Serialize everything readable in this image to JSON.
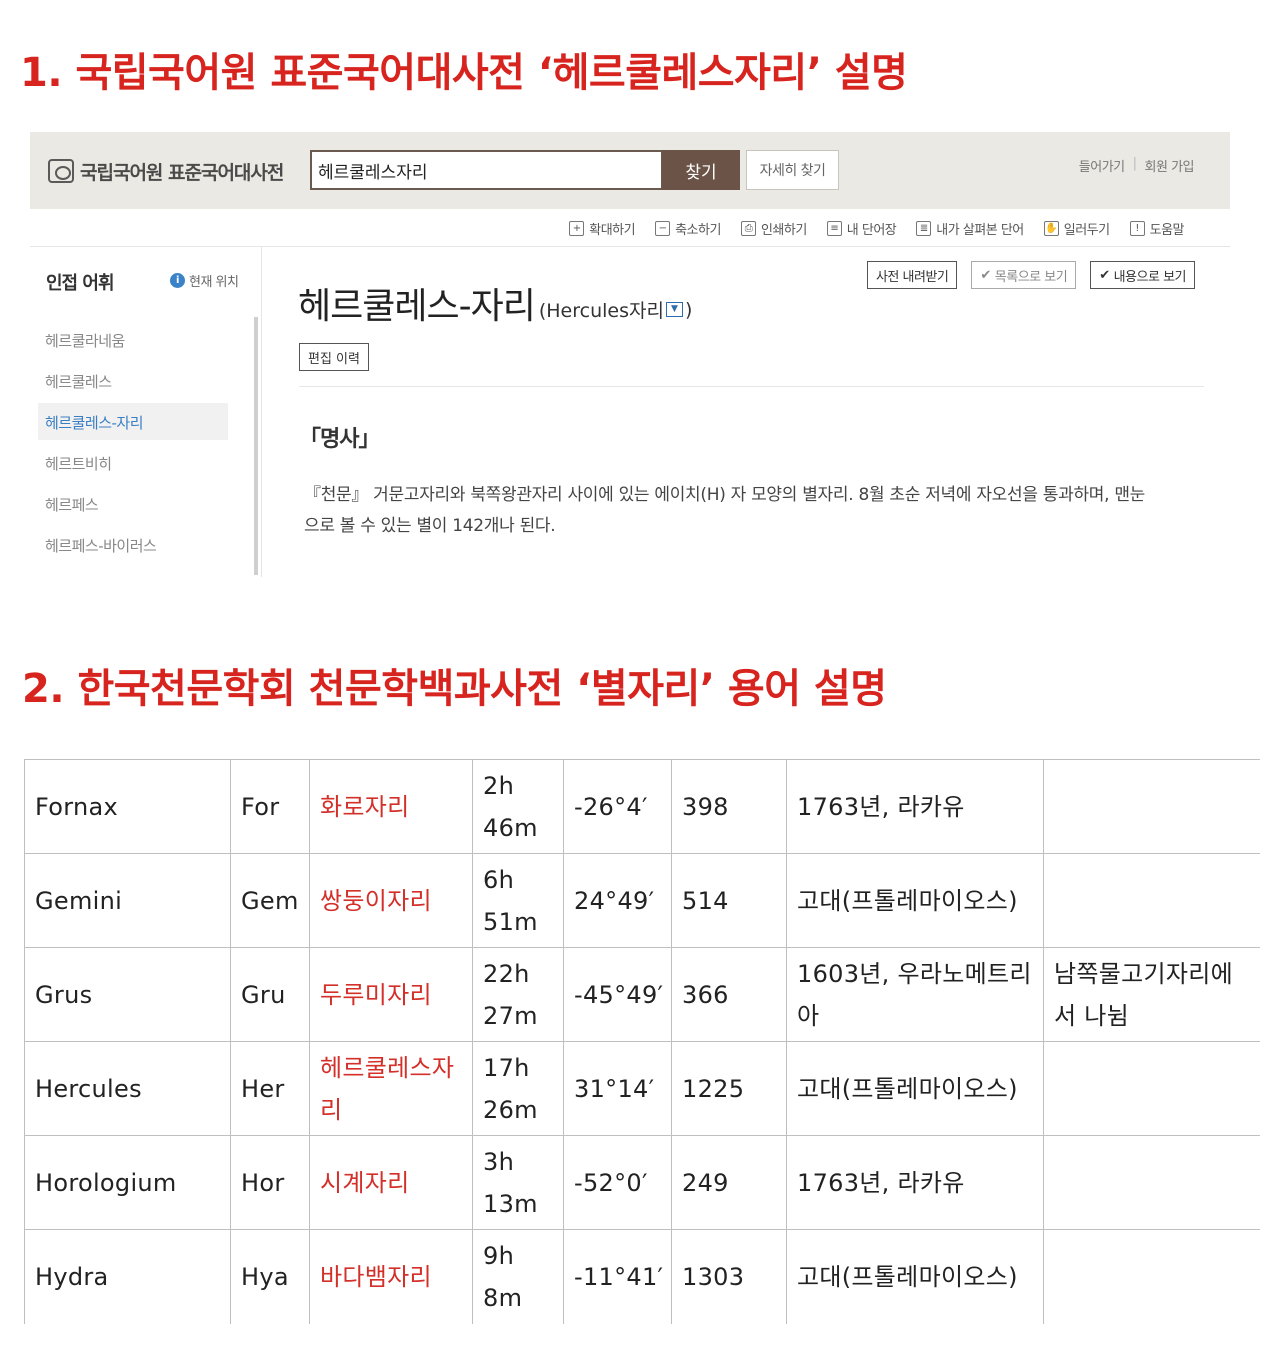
{
  "headings": {
    "first": "1. 국립국어원 표준국어대사전 ‘헤르쿨레스자리’ 설명",
    "second": "2. 한국천문학회 천문학백과사전 ‘별자리’ 용어 설명"
  },
  "dictionary": {
    "logo_text": "국립국어원 표준국어대사전",
    "search": {
      "value": "헤르쿨레스자리",
      "button": "찾기",
      "detail_button": "자세히 찾기"
    },
    "auth": {
      "login": "들어가기",
      "signup": "회원 가입"
    },
    "toolbar": [
      {
        "icon": "zoom-in-icon",
        "glyph": "+",
        "label": "확대하기"
      },
      {
        "icon": "zoom-out-icon",
        "glyph": "−",
        "label": "축소하기"
      },
      {
        "icon": "print-icon",
        "glyph": "⎙",
        "label": "인쇄하기"
      },
      {
        "icon": "wordbook-icon",
        "glyph": "≡",
        "label": "내 단어장"
      },
      {
        "icon": "viewed-words-icon",
        "glyph": "≣",
        "label": "내가 살펴본 단어"
      },
      {
        "icon": "report-icon",
        "glyph": "✋",
        "label": "일러두기"
      },
      {
        "icon": "help-icon",
        "glyph": "!",
        "label": "도움말"
      }
    ],
    "sidebar": {
      "title": "인접 어휘",
      "location": "현재 위치",
      "items": [
        {
          "label": "헤르쿨라네움",
          "active": false
        },
        {
          "label": "헤르쿨레스",
          "active": false
        },
        {
          "label": "헤르쿨레스-자리",
          "active": true
        },
        {
          "label": "헤르트비히",
          "active": false
        },
        {
          "label": "헤르페스",
          "active": false
        },
        {
          "label": "헤르페스-바이러스",
          "active": false
        }
      ]
    },
    "buttons": {
      "download": "사전 내려받기",
      "list_view": "목록으로 보기",
      "content_view": "내용으로 보기",
      "history": "편집 이력"
    },
    "entry": {
      "word": "헤르쿨레스-자리",
      "origin": "(Hercules자리",
      "origin_close": ")",
      "part_of_speech": "「명사」",
      "definition": "『천문』 거문고자리와 북쪽왕관자리 사이에 있는 에이치(H) 자 모양의 별자리. 8월 초순 저녁에 자오선을 통과하며, 맨눈으로 볼 수 있는 별이 142개나 된다."
    }
  },
  "constellations": {
    "rows": [
      {
        "latin": "Fornax",
        "abbr": "For",
        "korean": "화로자리",
        "ra": "2h 46m",
        "dec": "-26°4′",
        "area": "398",
        "origin": "1763년, 라카유",
        "note": ""
      },
      {
        "latin": "Gemini",
        "abbr": "Gem",
        "korean": "쌍둥이자리",
        "ra": "6h 51m",
        "dec": "24°49′",
        "area": "514",
        "origin": "고대(프톨레마이오스)",
        "note": ""
      },
      {
        "latin": "Grus",
        "abbr": "Gru",
        "korean": "두루미자리",
        "ra": "22h 27m",
        "dec": "-45°49′",
        "area": "366",
        "origin": "1603년, 우라노메트리아",
        "note": "남쪽물고기자리에서 나뉨"
      },
      {
        "latin": "Hercules",
        "abbr": "Her",
        "korean": "헤르쿨레스자리",
        "ra": "17h 26m",
        "dec": "31°14′",
        "area": "1225",
        "origin": "고대(프톨레마이오스)",
        "note": ""
      },
      {
        "latin": "Horologium",
        "abbr": "Hor",
        "korean": "시계자리",
        "ra": "3h 13m",
        "dec": "-52°0′",
        "area": "249",
        "origin": "1763년, 라카유",
        "note": ""
      },
      {
        "latin": "Hydra",
        "abbr": "Hya",
        "korean": "바다뱀자리",
        "ra": "9h 8m",
        "dec": "-11°41′",
        "area": "1303",
        "origin": "고대(프톨레마이오스)",
        "note": ""
      }
    ]
  },
  "colors": {
    "heading": "#d7241e",
    "korean_name": "#d3302a",
    "search_button": "#6b5447",
    "active_item": "#3a7fc4",
    "topbar": "#ebe9e3"
  }
}
